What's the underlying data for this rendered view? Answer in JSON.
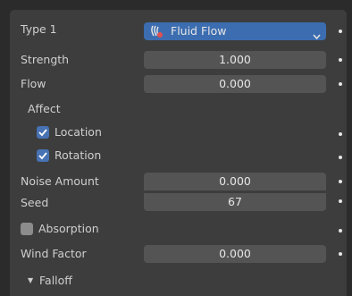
{
  "props": {
    "type_label": "Type 1",
    "type_value": "Fluid Flow",
    "strength_label": "Strength",
    "strength_value": "1.000",
    "flow_label": "Flow",
    "flow_value": "0.000",
    "affect_label": "Affect",
    "location_label": "Location",
    "location_checked": true,
    "rotation_label": "Rotation",
    "rotation_checked": true,
    "noise_label": "Noise Amount",
    "noise_value": "0.000",
    "seed_label": "Seed",
    "seed_value": "67",
    "absorption_label": "Absorption",
    "absorption_checked": false,
    "wind_label": "Wind Factor",
    "wind_value": "0.000",
    "falloff_label": "Falloff"
  },
  "icons": {
    "type_icon": "fluid-flow-icon",
    "dropdown": "chevron-down-icon",
    "checkbox_on": "check-icon",
    "falloff_toggle": "triangle-down-icon"
  },
  "colors": {
    "panel": "#3d3d3d",
    "field": "#545454",
    "accent": "#4772b3",
    "dropdown": "#3c6db0"
  }
}
